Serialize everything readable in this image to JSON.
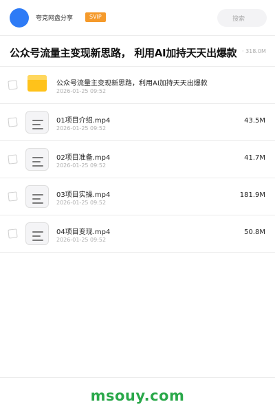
{
  "header": {
    "app_name": "夸克网盘分享",
    "badge": "SVIP",
    "search_label": "搜索"
  },
  "folder": {
    "title": "公众号流量主变现新思路， 利用AI加持天天出爆款",
    "size": "· 318.0M"
  },
  "files": [
    {
      "name": "公众号流量主变现新思路，利用AI加持天天出爆款",
      "date": "2026-01-25 09:52",
      "size": "",
      "type": "folder"
    },
    {
      "name": "01项目介绍.mp4",
      "date": "2026-01-25 09:52",
      "size": "43.5M",
      "type": "video"
    },
    {
      "name": "02项目准备.mp4",
      "date": "2026-01-25 09:52",
      "size": "41.7M",
      "type": "video"
    },
    {
      "name": "03项目实操.mp4",
      "date": "2026-01-25 09:52",
      "size": "181.9M",
      "type": "video"
    },
    {
      "name": "04项目变现.mp4",
      "date": "2026-01-25 09:52",
      "size": "50.8M",
      "type": "video"
    }
  ],
  "footer": {
    "watermark": "msouy.com"
  },
  "colors": {
    "accent_blue": "#2e7bf6",
    "svip_orange": "#f59a2b",
    "folder_yellow": "#ffc21a",
    "watermark_green": "#2aa84a"
  }
}
